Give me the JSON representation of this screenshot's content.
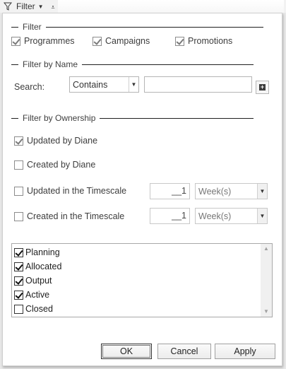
{
  "topbar": {
    "filter_label": "Filter"
  },
  "filter_group": {
    "title": "Filter",
    "options": [
      {
        "label": "Programmes",
        "checked": true
      },
      {
        "label": "Campaigns",
        "checked": true
      },
      {
        "label": "Promotions",
        "checked": true
      }
    ]
  },
  "name_group": {
    "title": "Filter by Name",
    "search_label": "Search:",
    "match_mode": "Contains",
    "search_value": ""
  },
  "ownership_group": {
    "title": "Filter by Ownership",
    "updated_by": {
      "label": "Updated by Diane",
      "checked": true
    },
    "created_by": {
      "label": "Created by Diane",
      "checked": false
    },
    "updated_timescale": {
      "label": "Updated in the Timescale",
      "checked": false,
      "value": "__1",
      "unit": "Week(s)"
    },
    "created_timescale": {
      "label": "Created in the Timescale",
      "checked": false,
      "value": "__1",
      "unit": "Week(s)"
    }
  },
  "status_list": [
    {
      "label": "Planning",
      "checked": true
    },
    {
      "label": "Allocated",
      "checked": true
    },
    {
      "label": "Output",
      "checked": true
    },
    {
      "label": "Active",
      "checked": true
    },
    {
      "label": "Closed",
      "checked": false
    }
  ],
  "buttons": {
    "ok": "OK",
    "cancel": "Cancel",
    "apply": "Apply"
  }
}
